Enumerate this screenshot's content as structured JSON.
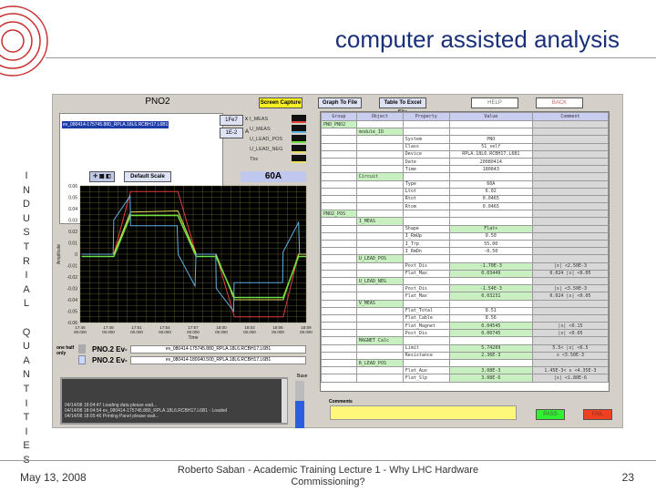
{
  "slide": {
    "title": "computer assisted analysis",
    "vertical_text": "INDUSTRIAL QUANTITIES",
    "date": "May 13, 2008",
    "footer": "Roberto Saban - Academic Training Lecture 1 - Why LHC Hardware Commissioning?",
    "page": "23"
  },
  "app": {
    "title": "PNO2",
    "buttons": {
      "screen_capture": "Screen Capture",
      "graph_to_file": "Graph To File",
      "table_to_excel": "Table To Excel File",
      "help": "HELP",
      "back": "BACK",
      "default_scale": "Default Scale",
      "pass": "PASS",
      "fail": "FAIL"
    },
    "selected_event": "ev_080414-175745.880_RPLA.18L6.RCBH17.L6B1",
    "scale_x": "1Fe7",
    "scale_x_unit": "x",
    "scale_a": "1E-2",
    "scale_a_unit": "A",
    "legend": [
      {
        "label": "I_MEAS",
        "color": "#e04040"
      },
      {
        "label": "U_MEAS",
        "color": "#60b0e0"
      },
      {
        "label": "U_LEAD_POS",
        "color": "#70e040"
      },
      {
        "label": "U_LEAD_NEG",
        "color": "#e8e060"
      },
      {
        "label": "Tbx",
        "color": "#e8e060"
      }
    ],
    "current_label": "60A",
    "one_half_only": "one half only",
    "events": [
      {
        "label": "PNO.2 Ev-",
        "value": "ev_080414-175745.880_RPLA.18L6.RCBH17.L6B1"
      },
      {
        "label": "PNO.2 Ev-",
        "value": "ev_080414-180040.500_RPLA.18L6.RCBH17.L6B1"
      }
    ],
    "log": [
      "04/14/08 18:04:47 Loading data please wait...",
      "04/14/08 18:04:54 ev_080414-175745.880_RPLA.18L6.RCBH17.L6B1 - Loaded",
      "04/14/08 18:05:46 Printing Panel please wait..."
    ],
    "base_label": "Base",
    "comments_label": "Comments",
    "comments_value": "",
    "table": {
      "headers": [
        "Group",
        "Object",
        "Property",
        "Value",
        "Comment"
      ],
      "rows": [
        [
          "PNO_PNO2",
          "",
          "",
          "",
          ""
        ],
        [
          "",
          "module_ID",
          "",
          "",
          ""
        ],
        [
          "",
          "",
          "System",
          "PNO",
          ""
        ],
        [
          "",
          "",
          "Class",
          "51_self",
          ""
        ],
        [
          "",
          "",
          "Device",
          "RPLA.18L6.RCBH17.L6B1",
          ""
        ],
        [
          "",
          "",
          "Date",
          "20080414",
          ""
        ],
        [
          "",
          "",
          "Time",
          "180843",
          ""
        ],
        [
          "",
          "Circuit",
          "",
          "",
          ""
        ],
        [
          "",
          "",
          "Type",
          "60A",
          ""
        ],
        [
          "",
          "",
          "Ltot",
          "6.02",
          ""
        ],
        [
          "",
          "",
          "Rtot",
          "0.0465",
          ""
        ],
        [
          "",
          "",
          "Rtom",
          "0.0465",
          ""
        ],
        [
          "PNO2_POS",
          "",
          "",
          "",
          ""
        ],
        [
          "",
          "I_MEAS",
          "",
          "",
          ""
        ],
        [
          "",
          "",
          "Shape",
          "Flat+",
          ""
        ],
        [
          "",
          "",
          "I_RmUp",
          "0.50",
          ""
        ],
        [
          "",
          "",
          "I_Trp",
          "55.00",
          ""
        ],
        [
          "",
          "",
          "I_RmDn",
          "-0.50",
          ""
        ],
        [
          "",
          "U_LEAD_POS",
          "",
          "",
          ""
        ],
        [
          "",
          "",
          "Post_Dis",
          "-1.70E-3",
          "|x| <2.50E-3"
        ],
        [
          "",
          "",
          "Flat_Max",
          "0.03449",
          "0.024 |x| <0.05"
        ],
        [
          "",
          "U_LEAD_NEG",
          "",
          "",
          ""
        ],
        [
          "",
          "",
          "Post_Dis",
          "-1.54E-3",
          "|x| <3.50E-3"
        ],
        [
          "",
          "",
          "Flat_Max",
          "0.03231",
          "0.024 |x| <0.05"
        ],
        [
          "",
          "V_MEAS",
          "",
          "",
          ""
        ],
        [
          "",
          "",
          "Flat_Total",
          "8.51",
          ""
        ],
        [
          "",
          "",
          "Flat_Cable",
          "8.56",
          ""
        ],
        [
          "",
          "",
          "Flat_Magnet",
          "0.04545",
          "|x| <0.15"
        ],
        [
          "",
          "",
          "Post_Dis",
          "0.00745",
          "|x| <0.05"
        ],
        [
          "",
          "MAGNET Calc",
          "",
          "",
          ""
        ],
        [
          "",
          "",
          "Limit",
          "5.74209",
          "5.5< |x| <6.5"
        ],
        [
          "",
          "",
          "Resistance",
          "2.36E-3",
          "x <3.50E-3"
        ],
        [
          "",
          "R_LEAD_POS",
          "",
          "",
          ""
        ],
        [
          "",
          "",
          "Flat_Aux",
          "3.08E-3",
          "1.45E-3< x <4.35E-3"
        ],
        [
          "",
          "",
          "Flat_Slp",
          "3.08E-6",
          "|x| <1.80E-6"
        ]
      ]
    }
  },
  "chart_data": {
    "type": "line",
    "xlabel": "Time",
    "ylabel": "Amplitude",
    "ylim": [
      -0.06,
      0.06
    ],
    "xlim": [
      0,
      24
    ],
    "x_ticks": [
      "17:45 00.000",
      "17:48 00.000",
      "17:51 00.000",
      "17:54 00.000",
      "17:57 00.000",
      "18:00 00.000",
      "18:03 00.000",
      "18:06 00.000",
      "18:09 00.000"
    ],
    "y_ticks": [
      "0.06",
      "0.05",
      "0.04",
      "0.03",
      "0.02",
      "0.01",
      "0",
      "-0.01",
      "-0.02",
      "-0.03",
      "-0.04",
      "-0.05",
      "-0.06"
    ],
    "series": [
      {
        "name": "I_MEAS",
        "color": "#e04040",
        "points": [
          [
            0.16,
            0
          ],
          [
            3.57,
            0
          ],
          [
            5.35,
            0.055
          ],
          [
            10.38,
            0.055
          ],
          [
            12.32,
            0
          ],
          [
            14.43,
            0
          ],
          [
            16.38,
            -0.055
          ],
          [
            21.57,
            -0.055
          ],
          [
            23.19,
            0
          ],
          [
            24,
            0
          ]
        ]
      },
      {
        "name": "U_LEAD_NEG",
        "color": "#e8e060",
        "points": [
          [
            0.16,
            0
          ],
          [
            3.57,
            0
          ],
          [
            5.35,
            0.037
          ],
          [
            10.38,
            0.038
          ],
          [
            12.32,
            0
          ],
          [
            14.43,
            0
          ],
          [
            16.38,
            -0.04
          ],
          [
            21.57,
            -0.04
          ],
          [
            23.19,
            0
          ],
          [
            24,
            0
          ]
        ]
      },
      {
        "name": "U_LEAD_POS",
        "color": "#70e040",
        "points": [
          [
            0.16,
            -0.002
          ],
          [
            3.57,
            -0.002
          ],
          [
            5.35,
            0.034
          ],
          [
            10.38,
            0.034
          ],
          [
            12.32,
            -0.002
          ],
          [
            14.43,
            -0.002
          ],
          [
            16.38,
            -0.038
          ],
          [
            21.57,
            -0.038
          ],
          [
            23.19,
            -0.002
          ],
          [
            24,
            -0.002
          ]
        ]
      },
      {
        "name": "U_MEAS",
        "color": "#60b0e0",
        "points": [
          [
            0.16,
            0
          ],
          [
            3.5,
            0
          ],
          [
            3.57,
            0.03
          ],
          [
            5.3,
            0.051
          ],
          [
            5.35,
            0.025
          ],
          [
            10.3,
            0.025
          ],
          [
            10.4,
            0
          ],
          [
            12.2,
            -0.028
          ],
          [
            12.3,
            0
          ],
          [
            14.4,
            0
          ],
          [
            14.45,
            -0.03
          ],
          [
            16.3,
            -0.05
          ],
          [
            16.35,
            -0.025
          ],
          [
            21.5,
            -0.025
          ],
          [
            21.55,
            0.002
          ],
          [
            23.2,
            0.028
          ],
          [
            23.3,
            0
          ]
        ]
      }
    ]
  }
}
